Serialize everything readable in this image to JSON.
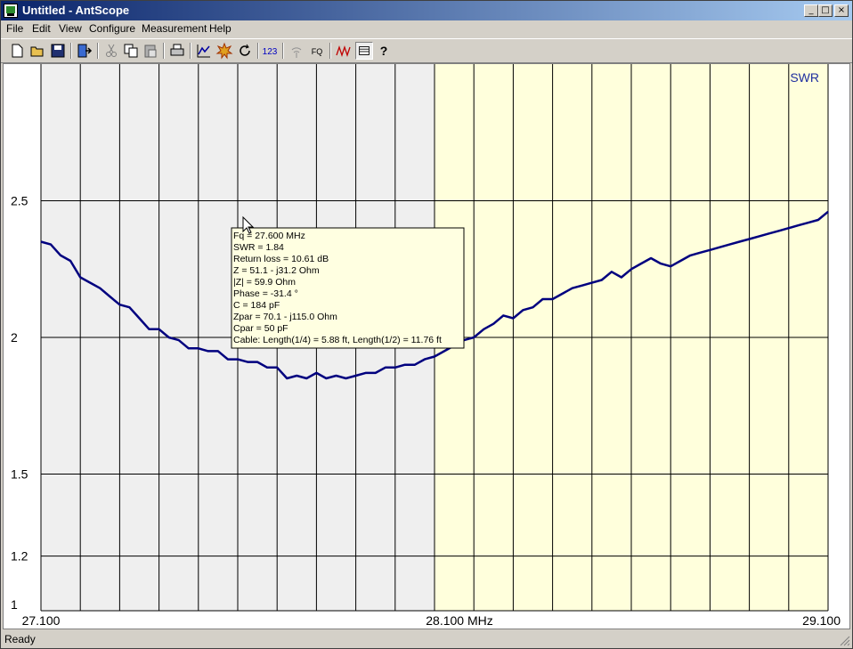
{
  "window": {
    "title": "Untitled - AntScope"
  },
  "title_buttons": {
    "minimize": "_",
    "maximize": "□",
    "close": "×"
  },
  "menu": [
    "File",
    "Edit",
    "View",
    "Configure",
    "Measurement",
    "Help"
  ],
  "toolbar": {
    "tools": [
      "new-icon",
      "open-icon",
      "save-icon",
      "export-icon",
      "cut-icon",
      "copy-icon",
      "paste-icon",
      "print-icon",
      "graph-icon",
      "scan-icon",
      "refresh-icon",
      "numbers-icon",
      "antenna-icon",
      "frequency-icon",
      "smith-icon",
      "table-icon",
      "help-icon"
    ],
    "numbers_label": "123",
    "fq_label": "FQ",
    "help_label": "?"
  },
  "status": {
    "text": "Ready"
  },
  "colors": {
    "left_band": "#efefef",
    "right_band": "#ffffdc",
    "line": "#00007f",
    "tooltip_bg": "#ffffe1",
    "swr_label": "#1f2f9f"
  },
  "chart_data": {
    "type": "line",
    "series_label": "SWR",
    "x_min": 27.1,
    "x_max": 29.1,
    "y_min": 1,
    "y_max": 3,
    "yticks": [
      1,
      1.2,
      1.5,
      2,
      2.5
    ],
    "ytick_labels": [
      "1",
      "1.2",
      "1.5",
      "2",
      "2.5"
    ],
    "xtick_labels": [
      "27.100",
      "28.100 MHz",
      "29.100"
    ],
    "x_grid_count": 20,
    "band_split": 28.1,
    "cursor_freq": 27.6,
    "x": [
      27.1,
      27.125,
      27.15,
      27.175,
      27.2,
      27.225,
      27.25,
      27.275,
      27.3,
      27.325,
      27.35,
      27.375,
      27.4,
      27.425,
      27.45,
      27.475,
      27.5,
      27.525,
      27.55,
      27.575,
      27.6,
      27.625,
      27.65,
      27.675,
      27.7,
      27.725,
      27.75,
      27.775,
      27.8,
      27.825,
      27.85,
      27.875,
      27.9,
      27.925,
      27.95,
      27.975,
      28.0,
      28.025,
      28.05,
      28.075,
      28.1,
      28.125,
      28.15,
      28.175,
      28.2,
      28.225,
      28.25,
      28.275,
      28.3,
      28.325,
      28.35,
      28.375,
      28.4,
      28.425,
      28.45,
      28.475,
      28.5,
      28.525,
      28.55,
      28.575,
      28.6,
      28.625,
      28.65,
      28.675,
      28.7,
      28.725,
      28.75,
      28.775,
      28.8,
      28.825,
      28.85,
      28.875,
      28.9,
      28.925,
      28.95,
      28.975,
      29.0,
      29.025,
      29.05,
      29.075,
      29.1
    ],
    "y": [
      2.35,
      2.34,
      2.3,
      2.28,
      2.22,
      2.2,
      2.18,
      2.15,
      2.12,
      2.11,
      2.07,
      2.03,
      2.03,
      2.0,
      1.99,
      1.96,
      1.96,
      1.95,
      1.95,
      1.92,
      1.92,
      1.91,
      1.91,
      1.89,
      1.89,
      1.85,
      1.86,
      1.85,
      1.87,
      1.85,
      1.86,
      1.85,
      1.86,
      1.87,
      1.87,
      1.89,
      1.89,
      1.9,
      1.9,
      1.92,
      1.93,
      1.95,
      1.97,
      1.99,
      2.0,
      2.03,
      2.05,
      2.08,
      2.07,
      2.1,
      2.11,
      2.14,
      2.14,
      2.16,
      2.18,
      2.19,
      2.2,
      2.21,
      2.24,
      2.22,
      2.25,
      2.27,
      2.29,
      2.27,
      2.26,
      2.28,
      2.3,
      2.31,
      2.32,
      2.33,
      2.34,
      2.35,
      2.36,
      2.37,
      2.38,
      2.39,
      2.4,
      2.41,
      2.42,
      2.43,
      2.46
    ]
  },
  "tooltip": {
    "lines": [
      "Fq = 27.600 MHz",
      "SWR = 1.84",
      "Return loss = 10.61 dB",
      "Z = 51.1 - j31.2 Ohm",
      "|Z| = 59.9 Ohm",
      "Phase = -31.4 °",
      "C = 184 pF",
      "Zpar = 70.1 - j115.0 Ohm",
      "Cpar = 50 pF",
      "Cable: Length(1/4) = 5.88 ft, Length(1/2) = 11.76 ft"
    ]
  }
}
